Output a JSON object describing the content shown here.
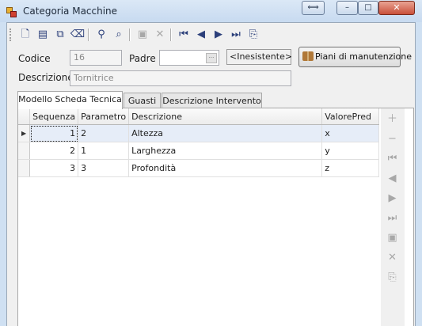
{
  "window": {
    "title": "Categoria Macchine",
    "restore_icon": "⟺",
    "minimize_icon": "–",
    "maximize_icon": "□",
    "close_icon": "✕"
  },
  "toolbar": [
    {
      "name": "new-document-icon",
      "glyph": "🗋",
      "enabled": true
    },
    {
      "name": "edit-form-icon",
      "glyph": "▤",
      "enabled": true
    },
    {
      "name": "copy-icon",
      "glyph": "⧉",
      "enabled": true
    },
    {
      "name": "eraser-icon",
      "glyph": "⌫",
      "enabled": true
    },
    {
      "name": "find-binoculars-icon",
      "glyph": "⚲",
      "enabled": true
    },
    {
      "name": "find-in-form-icon",
      "glyph": "⌕",
      "enabled": true
    },
    {
      "name": "save-icon",
      "glyph": "▣",
      "enabled": false
    },
    {
      "name": "delete-icon",
      "glyph": "✕",
      "enabled": false
    },
    {
      "name": "first-record-icon",
      "glyph": "⏮",
      "enabled": true
    },
    {
      "name": "previous-record-icon",
      "glyph": "◀",
      "enabled": true
    },
    {
      "name": "next-record-icon",
      "glyph": "▶",
      "enabled": true
    },
    {
      "name": "last-record-icon",
      "glyph": "⏭",
      "enabled": true
    },
    {
      "name": "attachment-icon",
      "glyph": "⎘",
      "enabled": true
    }
  ],
  "form": {
    "codice_label": "Codice",
    "codice_value": "16",
    "padre_label": "Padre",
    "padre_value": "",
    "padre_lookup_icon": "···",
    "padre_display": "<Inesistente>",
    "descrizione_label": "Descrizione",
    "descrizione_value": "Tornitrice",
    "piani_button": "Piani di manutenzione"
  },
  "tabs": [
    {
      "label": "Modello Scheda Tecnica",
      "active": true
    },
    {
      "label": "Guasti",
      "active": false
    },
    {
      "label": "Descrizione Intervento",
      "active": false
    }
  ],
  "grid": {
    "columns": [
      "Sequenza",
      "Parametro",
      "Descrizione",
      "ValorePred"
    ],
    "current_row_marker": "▶",
    "rows": [
      {
        "sequenza": "1",
        "parametro": "2",
        "descrizione": "Altezza",
        "valore": "x"
      },
      {
        "sequenza": "2",
        "parametro": "1",
        "descrizione": "Larghezza",
        "valore": "y"
      },
      {
        "sequenza": "3",
        "parametro": "3",
        "descrizione": "Profondità",
        "valore": "z"
      }
    ]
  },
  "side_toolbar": [
    {
      "name": "add-row-icon",
      "glyph": "＋"
    },
    {
      "name": "remove-row-icon",
      "glyph": "−"
    },
    {
      "name": "first-row-icon",
      "glyph": "⏮"
    },
    {
      "name": "previous-row-icon",
      "glyph": "◀"
    },
    {
      "name": "next-row-icon",
      "glyph": "▶"
    },
    {
      "name": "last-row-icon",
      "glyph": "⏭"
    },
    {
      "name": "save-row-icon",
      "glyph": "▣"
    },
    {
      "name": "cancel-row-icon",
      "glyph": "✕"
    },
    {
      "name": "attach-row-icon",
      "glyph": "⎘"
    }
  ]
}
